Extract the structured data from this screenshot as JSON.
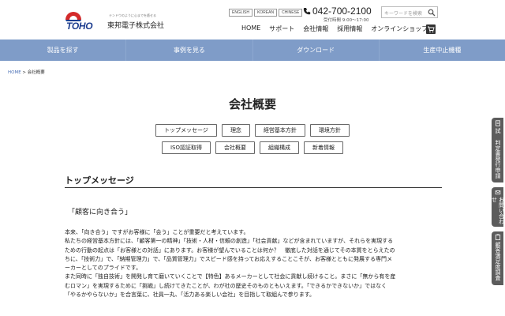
{
  "header": {
    "logo_tagline": "テンドウのように心までを癒せる",
    "logo_brand": "TOHO",
    "logo_name": "東邦電子株式会社",
    "languages": [
      "ENGLISH",
      "KOREAN",
      "CHINESE"
    ],
    "phone": "042-700-2100",
    "hours": "受付時間 9:00～17:00",
    "search_placeholder": "キーワードを検索",
    "nav": [
      "HOME",
      "サポート",
      "会社情報",
      "採用情報",
      "オンラインショップ"
    ],
    "brand_color": "#1d3d8f"
  },
  "main_nav": {
    "items": [
      "製品を探す",
      "事例を見る",
      "ダウンロード",
      "生産中止機種"
    ],
    "bar_color": "#7f9cc8"
  },
  "breadcrumb": {
    "home": "HOME",
    "separator": " > ",
    "current": "会社概要"
  },
  "page": {
    "title": "会社概要",
    "subnav_row1": [
      "トップメッセージ",
      "理念",
      "経営基本方針",
      "環境方針"
    ],
    "subnav_row2": [
      "ISO認証取得",
      "会社概要",
      "組織構成",
      "新着情報"
    ]
  },
  "section": {
    "title": "トップメッセージ",
    "quote": "「顧客に向き合う」",
    "lines": [
      "本来、「向き合う」ですがお客様に「会う」ことが重要だと考えています。",
      "私たちの経営基本方針には、「顧客第一の精神」「技術・人材・信頼の創造」「社会貢献」などが含まれていますが、それらを実現する",
      "ための行動の起点は「お客様との対話」にあります。お客様が望んでいることは何か？　徹底した対話を通じてその本質をとらえたの",
      "ちに、「技術力」で、「納期管理力」で、「品質管理力」でスピード感を持ってお応えすることこそが、お客様とともに発展する専門メ",
      "ーカーとしてのプライドです。",
      "また同時に「独自技術」を開発し育て磨いていくことで【特色】あるメーカーとして社会に貢献し続けること。まさに「無から有を産",
      "むロマン」を実現するために「挑戦」し続けてきたことが、わが社の歴史そのものともいえます。「できるかできないか」ではなく",
      "「やるかやらないか」を合言葉に、社員一丸、「活力ある楽しい会社」を目指して取組んで参ります。"
    ]
  },
  "side_tabs": [
    {
      "label": "試 判定書発行申請",
      "icon": "document-icon"
    },
    {
      "label": "お問い合わせ",
      "icon": "mail-icon"
    },
    {
      "label": "顧客満足度調査",
      "icon": "clipboard-icon"
    }
  ]
}
